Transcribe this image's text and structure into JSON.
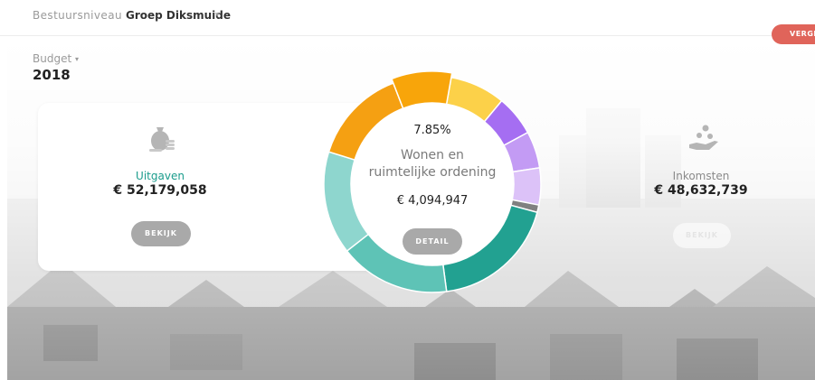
{
  "header": {
    "crumb_label": "Bestuursniveau",
    "crumb_value": "Groep Diksmuide",
    "crumb_caret": "▾",
    "compare_label": "VERGELIJ"
  },
  "budget": {
    "label": "Budget",
    "caret": "▾",
    "year": "2018"
  },
  "expenses": {
    "label": "Uitgaven",
    "value": "€ 52,179,058",
    "button": "BEKIJK",
    "icon": "money-bag-icon"
  },
  "income": {
    "label": "Inkomsten",
    "value": "€ 48,632,739",
    "button": "BEKIJK",
    "icon": "hand-coins-icon"
  },
  "selection": {
    "percentage": "7.85%",
    "name_line1": "Wonen en",
    "name_line2": "ruimtelijke ordening",
    "value": "€ 4,094,947",
    "button": "DETAIL"
  },
  "colors": {
    "accent_green": "#1a9c8c",
    "compare_red": "#e0645a",
    "button_grey": "#a9a9a9"
  },
  "chart_data": {
    "type": "pie",
    "slices": [
      {
        "value": 7.5,
        "color": "#fcd149"
      },
      {
        "value": 5.5,
        "color": "#a56ef2"
      },
      {
        "value": 5.0,
        "color": "#c39bf4"
      },
      {
        "value": 5.0,
        "color": "#dcc2f8"
      },
      {
        "value": 1.0,
        "color": "#808080"
      },
      {
        "value": 17.0,
        "color": "#22a191"
      },
      {
        "value": 15.0,
        "color": "#5ec3b6"
      },
      {
        "value": 14.0,
        "color": "#8ed6ce"
      },
      {
        "value": 13.0,
        "color": "#f5a012"
      },
      {
        "value": 7.85,
        "color": "#f8a50a"
      }
    ]
  }
}
